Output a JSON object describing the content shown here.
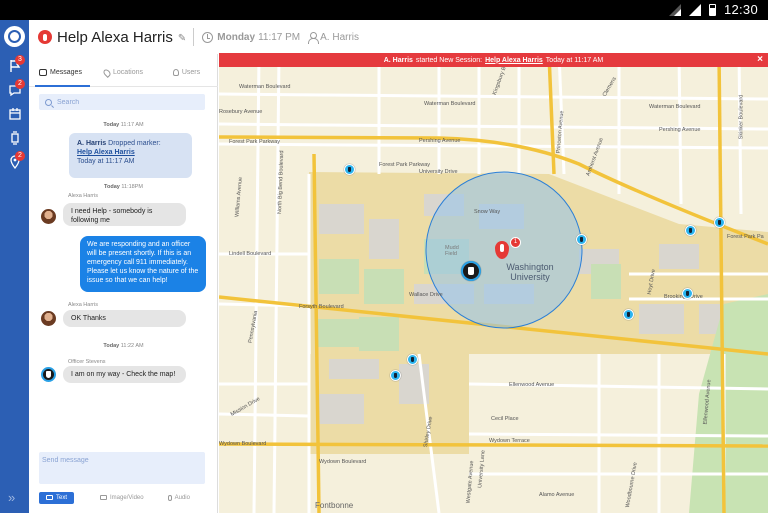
{
  "statusbar": {
    "time": "12:30"
  },
  "nav": {
    "badges": {
      "flags": "3",
      "chat": "2",
      "location": "2"
    }
  },
  "header": {
    "session_title": "Help Alexa Harris",
    "day": "Monday",
    "time": "11:17 PM",
    "user": "A. Harris"
  },
  "banner": {
    "actor": "A. Harris",
    "action": "started New Session:",
    "session_link": "Help Alexa Harris",
    "when": "Today at 11:17 AM"
  },
  "tabs": [
    {
      "label": "Messages",
      "active": true
    },
    {
      "label": "Locations",
      "active": false
    },
    {
      "label": "Users",
      "active": false
    }
  ],
  "search": {
    "placeholder": "Search"
  },
  "messages": {
    "stamp1_day": "Today",
    "stamp1_time": "11:17 AM",
    "sys_actor": "A. Harris",
    "sys_text": "Dropped marker:",
    "sys_link": "Help Alexa Harris",
    "sys_when": "Today at 11:17 AM",
    "stamp2_day": "Today",
    "stamp2_time": "11:18PM",
    "sender1": "Alexa Harris",
    "msg1": "I need Help - somebody is following me",
    "msg2": "We are responding and an officer will be present shortly. If this is an emergency call 911 immediately. Please let us know the nature of the issue so that we can help!",
    "sender2": "Alexa Harris",
    "msg3": "OK Thanks",
    "stamp3_day": "Today",
    "stamp3_time": "11:22 AM",
    "sender3": "Officer Stevens",
    "msg4": "I am on my way - Check the map!"
  },
  "composer": {
    "placeholder": "Send message",
    "modes": [
      "Text",
      "Image/Video",
      "Audio"
    ],
    "active_mode": "Text"
  },
  "map": {
    "labels": {
      "waterman_top": "Waterman Boulevard",
      "kingsbury": "Kingsbury Boulevard",
      "waterman_mid": "Waterman Boulevard",
      "waterman_right": "Waterman Boulevard",
      "pershing_left": "Pershing Avenue",
      "pershing_right": "Pershing Avenue",
      "forest_park_pkwy": "Forest Park Parkway",
      "forest_park_pkwy2": "Forest Park Parkway",
      "forest_park_pkwy_right": "Forest Park Pa",
      "north_big_bend": "North Big Bend Boulevard",
      "university_drive": "University Drive",
      "snow_way": "Snow Way",
      "mudd_field": "Mudd Field",
      "washington_university": "Washington University",
      "lindell": "Lindell Boulevard",
      "wallace": "Wallace Drive",
      "forsyth": "Forsyth Boulevard",
      "brookings": "Brookings Drive",
      "hoyt": "Hoyt Drive",
      "ellenwood": "Ellenwood Avenue",
      "ellenwood2": "Ellenwood Avenue",
      "cecil": "Cecil Place",
      "wydown_left": "Wydown Boulevard",
      "wydown_mid": "Wydown Boulevard",
      "wydown_terrace": "Wydown Terrace",
      "alamo": "Alamo Avenue",
      "westgate": "Westgate Avenue",
      "fontbonne": "Fontbonne",
      "woodbourne": "Woodbourne Drive",
      "shirley": "Shirley Drive",
      "university_lane": "University Lane",
      "skinker": "Skinker Boulevard",
      "pennsylvania": "Pennsylvania",
      "williams": "Williams Avenue",
      "clemens": "Clemens",
      "mission": "Mission Drive",
      "rosebury": "Rosebury Avenue",
      "princeton": "Princeton Avenue",
      "amherst": "Amherst Avenue"
    },
    "alert_count": "1"
  },
  "colors": {
    "nav_blue": "#2c5fb4",
    "alert_red": "#e53a3e",
    "bubble_blue": "#1b82e6",
    "marker_cyan": "#2bb4ef",
    "geofence": "#9ac5ea"
  }
}
